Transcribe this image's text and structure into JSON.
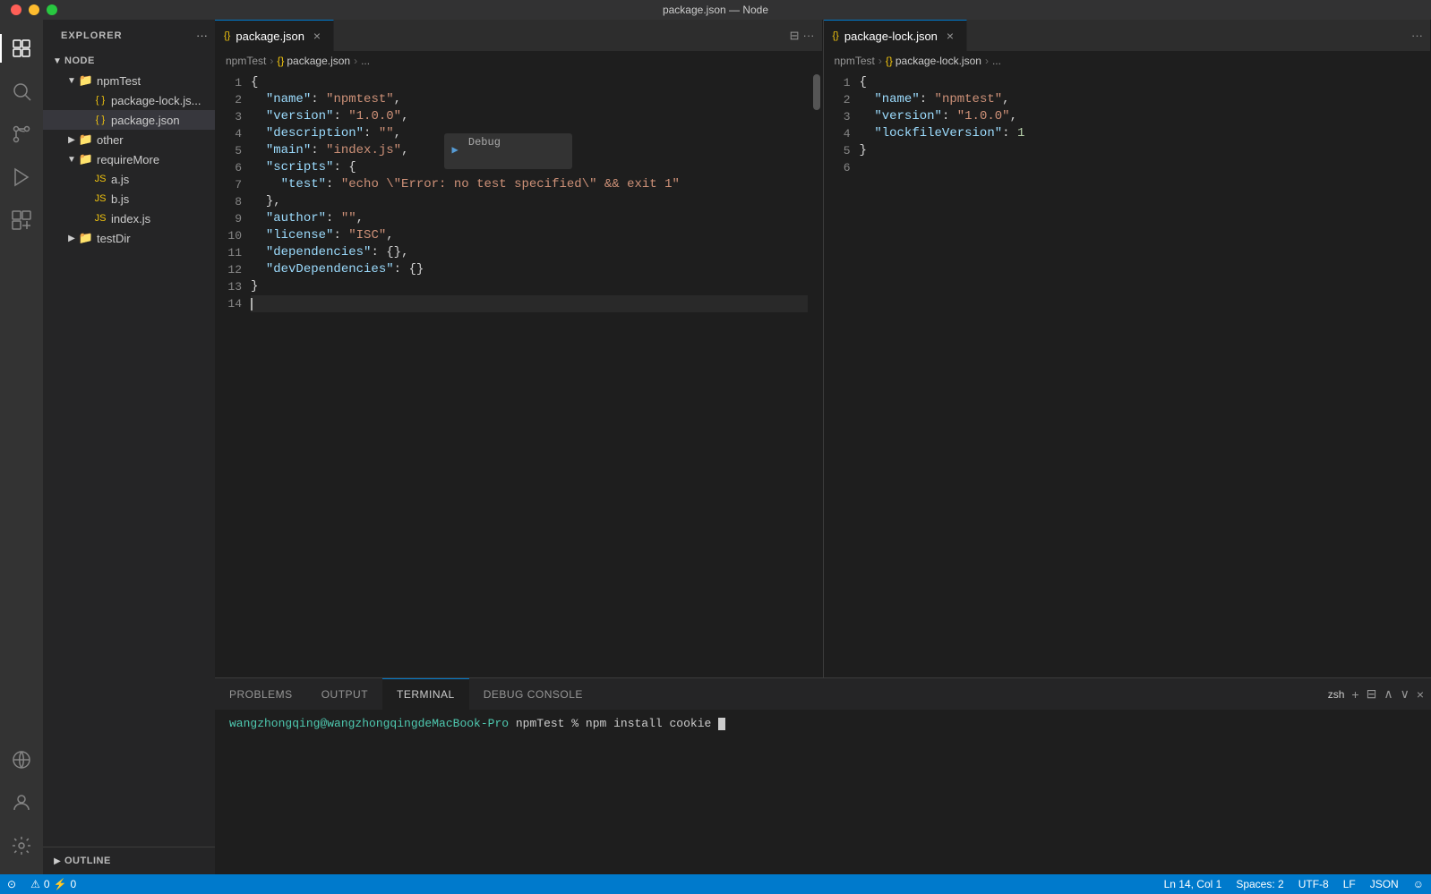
{
  "titleBar": {
    "title": "package.json — Node"
  },
  "activityBar": {
    "icons": [
      {
        "name": "explorer-icon",
        "label": "Explorer",
        "active": true,
        "symbol": "⊞"
      },
      {
        "name": "search-icon",
        "label": "Search",
        "active": false,
        "symbol": "🔍"
      },
      {
        "name": "source-control-icon",
        "label": "Source Control",
        "active": false,
        "symbol": "⎇"
      },
      {
        "name": "debug-icon",
        "label": "Run and Debug",
        "active": false,
        "symbol": "▶"
      },
      {
        "name": "extensions-icon",
        "label": "Extensions",
        "active": false,
        "symbol": "⧉"
      }
    ],
    "bottomIcons": [
      {
        "name": "remote-icon",
        "label": "Remote",
        "symbol": "⊙"
      },
      {
        "name": "account-icon",
        "label": "Account",
        "symbol": "◯"
      },
      {
        "name": "settings-icon",
        "label": "Settings",
        "symbol": "⚙"
      }
    ]
  },
  "sidebar": {
    "title": "EXPLORER",
    "tree": [
      {
        "id": "node",
        "label": "NODE",
        "type": "root-folder",
        "indent": 1,
        "expanded": true,
        "chevron": "▼"
      },
      {
        "id": "npmtest",
        "label": "npmTest",
        "type": "folder",
        "indent": 2,
        "expanded": true,
        "chevron": "▼"
      },
      {
        "id": "package-lock",
        "label": "package-lock.js...",
        "type": "file-json",
        "indent": 3,
        "chevron": ""
      },
      {
        "id": "package-json",
        "label": "package.json",
        "type": "file-json",
        "indent": 3,
        "chevron": "",
        "active": true
      },
      {
        "id": "other",
        "label": "other",
        "type": "folder",
        "indent": 2,
        "expanded": false,
        "chevron": "▶"
      },
      {
        "id": "requiremore",
        "label": "requireMore",
        "type": "folder",
        "indent": 2,
        "expanded": true,
        "chevron": "▼"
      },
      {
        "id": "ajs",
        "label": "a.js",
        "type": "file-js",
        "indent": 3,
        "chevron": ""
      },
      {
        "id": "bjs",
        "label": "b.js",
        "type": "file-js",
        "indent": 3,
        "chevron": ""
      },
      {
        "id": "indexjs",
        "label": "index.js",
        "type": "file-js",
        "indent": 3,
        "chevron": ""
      },
      {
        "id": "testdir",
        "label": "testDir",
        "type": "folder",
        "indent": 2,
        "expanded": false,
        "chevron": "▶"
      }
    ],
    "outline": {
      "label": "OUTLINE",
      "collapsed": true
    }
  },
  "editor1": {
    "tab": {
      "icon": "{}",
      "label": "package.json",
      "active": true
    },
    "breadcrumb": [
      "npmTest",
      "package.json",
      "..."
    ],
    "lines": [
      {
        "num": 1,
        "content": "{",
        "tokens": [
          {
            "text": "{",
            "class": "t-bracket"
          }
        ]
      },
      {
        "num": 2,
        "content": "  \"name\": \"npmtest\",",
        "tokens": [
          {
            "text": "  ",
            "class": "t-default"
          },
          {
            "text": "\"name\"",
            "class": "t-key"
          },
          {
            "text": ": ",
            "class": "t-default"
          },
          {
            "text": "\"npmtest\"",
            "class": "t-string"
          },
          {
            "text": ",",
            "class": "t-default"
          }
        ]
      },
      {
        "num": 3,
        "content": "  \"version\": \"1.0.0\",",
        "tokens": [
          {
            "text": "  ",
            "class": "t-default"
          },
          {
            "text": "\"version\"",
            "class": "t-key"
          },
          {
            "text": ": ",
            "class": "t-default"
          },
          {
            "text": "\"1.0.0\"",
            "class": "t-string"
          },
          {
            "text": ",",
            "class": "t-default"
          }
        ]
      },
      {
        "num": 4,
        "content": "  \"description\": \"\",",
        "tokens": [
          {
            "text": "  ",
            "class": "t-default"
          },
          {
            "text": "\"description\"",
            "class": "t-key"
          },
          {
            "text": ": ",
            "class": "t-default"
          },
          {
            "text": "\"\"",
            "class": "t-string"
          },
          {
            "text": ",",
            "class": "t-default"
          }
        ]
      },
      {
        "num": 5,
        "content": "  \"main\": \"index.js\",",
        "tokens": [
          {
            "text": "  ",
            "class": "t-default"
          },
          {
            "text": "\"main\"",
            "class": "t-key"
          },
          {
            "text": ": ",
            "class": "t-default"
          },
          {
            "text": "\"index.js\"",
            "class": "t-string"
          },
          {
            "text": ",",
            "class": "t-default"
          }
        ]
      },
      {
        "num": 6,
        "content": "  \"scripts\": {",
        "tokens": [
          {
            "text": "  ",
            "class": "t-default"
          },
          {
            "text": "\"scripts\"",
            "class": "t-key"
          },
          {
            "text": ": ",
            "class": "t-default"
          },
          {
            "text": "{",
            "class": "t-bracket"
          }
        ]
      },
      {
        "num": 7,
        "content": "    \"test\": \"echo \\\"Error: no test specified\\\" && exit 1\"",
        "tokens": [
          {
            "text": "    ",
            "class": "t-default"
          },
          {
            "text": "\"test\"",
            "class": "t-key"
          },
          {
            "text": ": ",
            "class": "t-default"
          },
          {
            "text": "\"echo \\\"Error: no test specified\\\" && exit 1\"",
            "class": "t-string"
          }
        ]
      },
      {
        "num": 8,
        "content": "  },",
        "tokens": [
          {
            "text": "  ",
            "class": "t-default"
          },
          {
            "text": "}",
            "class": "t-bracket"
          },
          {
            "text": ",",
            "class": "t-default"
          }
        ]
      },
      {
        "num": 9,
        "content": "  \"author\": \"\",",
        "tokens": [
          {
            "text": "  ",
            "class": "t-default"
          },
          {
            "text": "\"author\"",
            "class": "t-key"
          },
          {
            "text": ": ",
            "class": "t-default"
          },
          {
            "text": "\"\"",
            "class": "t-string"
          },
          {
            "text": ",",
            "class": "t-default"
          }
        ]
      },
      {
        "num": 10,
        "content": "  \"license\": \"ISC\",",
        "tokens": [
          {
            "text": "  ",
            "class": "t-default"
          },
          {
            "text": "\"license\"",
            "class": "t-key"
          },
          {
            "text": ": ",
            "class": "t-default"
          },
          {
            "text": "\"ISC\"",
            "class": "t-string"
          },
          {
            "text": ",",
            "class": "t-default"
          }
        ]
      },
      {
        "num": 11,
        "content": "  \"dependencies\": {},",
        "tokens": [
          {
            "text": "  ",
            "class": "t-default"
          },
          {
            "text": "\"dependencies\"",
            "class": "t-key"
          },
          {
            "text": ": ",
            "class": "t-default"
          },
          {
            "text": "{}",
            "class": "t-bracket"
          },
          {
            "text": ",",
            "class": "t-default"
          }
        ]
      },
      {
        "num": 12,
        "content": "  \"devDependencies\": {}",
        "tokens": [
          {
            "text": "  ",
            "class": "t-default"
          },
          {
            "text": "\"devDependencies\"",
            "class": "t-key"
          },
          {
            "text": ": ",
            "class": "t-default"
          },
          {
            "text": "{}",
            "class": "t-bracket"
          }
        ]
      },
      {
        "num": 13,
        "content": "}",
        "tokens": [
          {
            "text": "}",
            "class": "t-bracket"
          }
        ]
      },
      {
        "num": 14,
        "content": "",
        "tokens": []
      }
    ],
    "debugWidget": "▶ Debug"
  },
  "editor2": {
    "tab": {
      "icon": "{}",
      "label": "package-lock.json",
      "active": false
    },
    "breadcrumb": [
      "npmTest",
      "package-lock.json",
      "..."
    ],
    "lines": [
      {
        "num": 1,
        "content": "{",
        "tokens": [
          {
            "text": "{",
            "class": "t-bracket"
          }
        ]
      },
      {
        "num": 2,
        "content": "  \"name\": \"npmtest\",",
        "tokens": [
          {
            "text": "  ",
            "class": "t-default"
          },
          {
            "text": "\"name\"",
            "class": "t-key"
          },
          {
            "text": ": ",
            "class": "t-default"
          },
          {
            "text": "\"npmtest\"",
            "class": "t-string"
          },
          {
            "text": ",",
            "class": "t-default"
          }
        ]
      },
      {
        "num": 3,
        "content": "  \"version\": \"1.0.0\",",
        "tokens": [
          {
            "text": "  ",
            "class": "t-default"
          },
          {
            "text": "\"version\"",
            "class": "t-key"
          },
          {
            "text": ": ",
            "class": "t-default"
          },
          {
            "text": "\"1.0.0\"",
            "class": "t-string"
          },
          {
            "text": ",",
            "class": "t-default"
          }
        ]
      },
      {
        "num": 4,
        "content": "  \"lockfileVersion\": 1",
        "tokens": [
          {
            "text": "  ",
            "class": "t-default"
          },
          {
            "text": "\"lockfileVersion\"",
            "class": "t-key"
          },
          {
            "text": ": ",
            "class": "t-default"
          },
          {
            "text": "1",
            "class": "t-number"
          }
        ]
      },
      {
        "num": 5,
        "content": "}",
        "tokens": [
          {
            "text": "}",
            "class": "t-bracket"
          }
        ]
      },
      {
        "num": 6,
        "content": "",
        "tokens": []
      }
    ]
  },
  "panel": {
    "tabs": [
      {
        "label": "PROBLEMS",
        "active": false
      },
      {
        "label": "OUTPUT",
        "active": false
      },
      {
        "label": "TERMINAL",
        "active": true
      },
      {
        "label": "DEBUG CONSOLE",
        "active": false
      }
    ],
    "terminal": {
      "prompt": "wangzhongqing@wangzhongqingdeMacBook-Pro",
      "cwd": "npmTest",
      "symbol": "~",
      "command": "npm install cookie",
      "cursor": "|"
    },
    "terminalName": "zsh"
  },
  "statusBar": {
    "left": [
      {
        "icon": "remote-icon",
        "label": ""
      },
      {
        "icon": "errors-icon",
        "label": "⚠ 0"
      },
      {
        "icon": "warnings-icon",
        "label": "⚡ 0"
      }
    ],
    "right": [
      {
        "label": "Ln 14, Col 1"
      },
      {
        "label": "Spaces: 2"
      },
      {
        "label": "UTF-8"
      },
      {
        "label": "LF"
      },
      {
        "label": "JSON"
      },
      {
        "label": "☺"
      }
    ]
  }
}
